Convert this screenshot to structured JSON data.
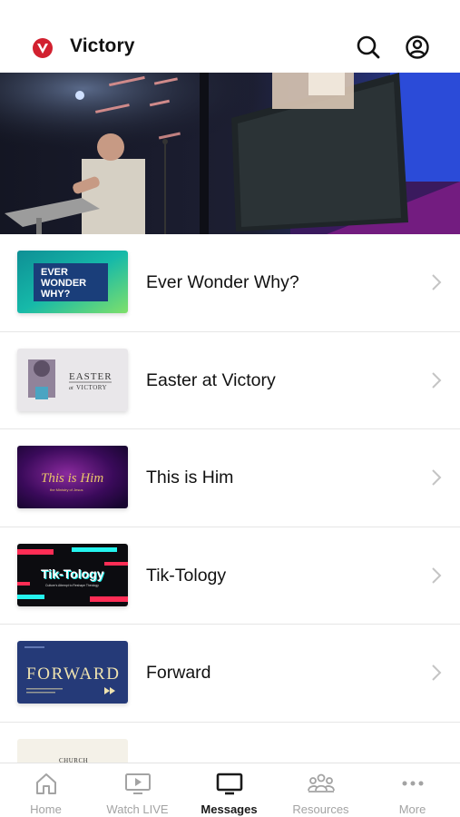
{
  "header": {
    "title": "Victory",
    "logo_icon": "victory-v-logo",
    "search_icon": "search-icon",
    "account_icon": "account-icon"
  },
  "hero": {
    "image": "preacher-on-stage-photo"
  },
  "series": [
    {
      "title": "Ever Wonder Why?",
      "thumb_text": [
        "EVER",
        "WONDER",
        "WHY?"
      ]
    },
    {
      "title": "Easter at Victory",
      "thumb_text": [
        "EASTER",
        "at",
        "VICTORY"
      ]
    },
    {
      "title": "This is Him",
      "thumb_text": [
        "This is Him",
        "the Ministry of Jesus"
      ]
    },
    {
      "title": "Tik-Tology",
      "thumb_text": [
        "Tik-Tology",
        "Culture's Attempt to Reshape Theology"
      ]
    },
    {
      "title": "Forward",
      "thumb_text": [
        "FORWARD"
      ]
    }
  ],
  "partial_item": {
    "thumb_text": "CHURCH"
  },
  "tabs": [
    {
      "label": "Home",
      "icon": "home-icon"
    },
    {
      "label": "Watch LIVE",
      "icon": "tv-play-icon"
    },
    {
      "label": "Messages",
      "icon": "tv-icon",
      "active": true
    },
    {
      "label": "Resources",
      "icon": "people-icon"
    },
    {
      "label": "More",
      "icon": "more-dots-icon"
    }
  ],
  "colors": {
    "brand": "#d2202f",
    "active_tab": "#1a1a1a",
    "inactive_tab": "#a3a3a3"
  }
}
